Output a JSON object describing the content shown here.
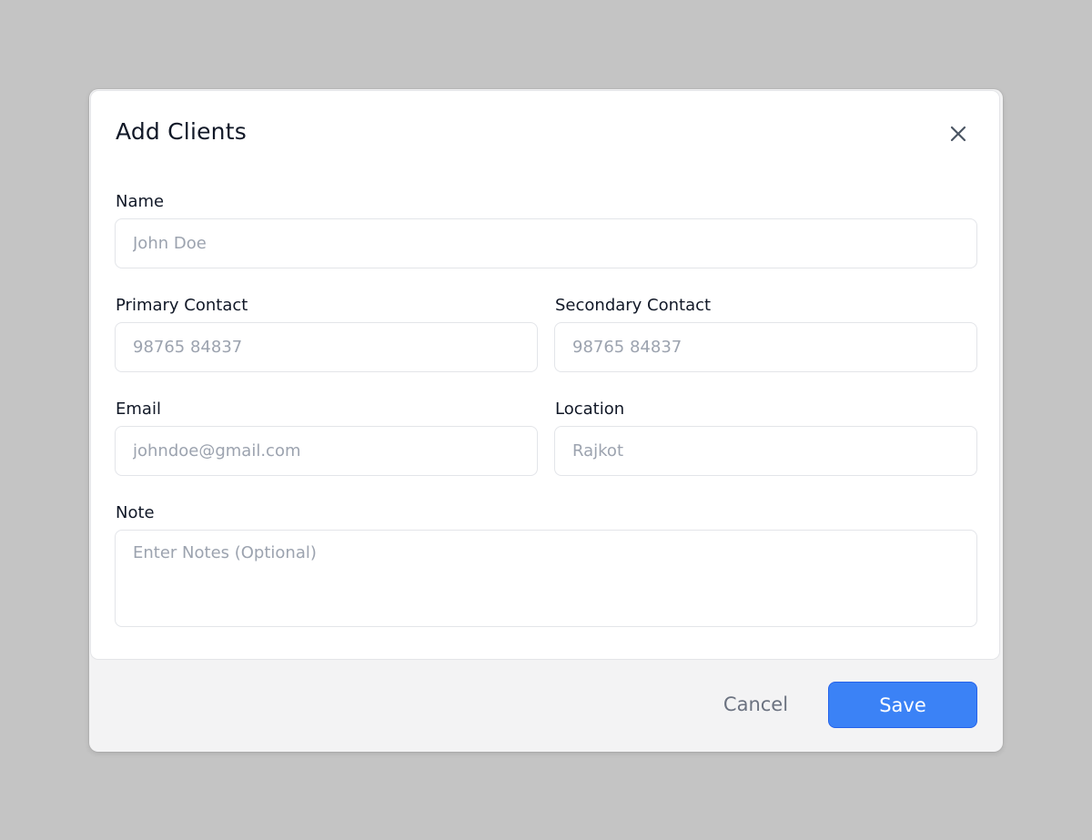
{
  "modal": {
    "title": "Add Clients",
    "close_icon": "close-icon"
  },
  "form": {
    "name": {
      "label": "Name",
      "placeholder": "John Doe"
    },
    "primary_contact": {
      "label": "Primary Contact",
      "placeholder": "98765 84837"
    },
    "secondary_contact": {
      "label": "Secondary Contact",
      "placeholder": "98765 84837"
    },
    "email": {
      "label": "Email",
      "placeholder": "johndoe@gmail.com"
    },
    "location": {
      "label": "Location",
      "placeholder": "Rajkot"
    },
    "note": {
      "label": "Note",
      "placeholder": "Enter Notes (Optional)"
    }
  },
  "footer": {
    "cancel_label": "Cancel",
    "save_label": "Save"
  },
  "colors": {
    "backdrop": "#c4c4c4",
    "primary": "#3b82f6",
    "footer_bg": "#f3f3f4"
  }
}
